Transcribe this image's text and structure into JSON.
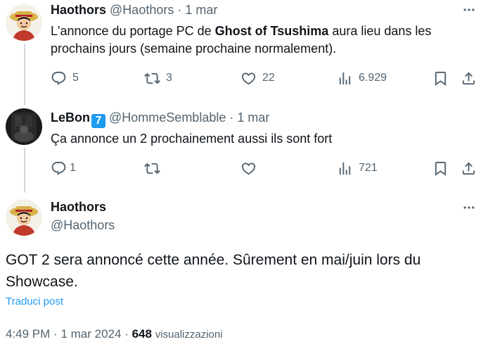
{
  "posts": [
    {
      "name": "Haothors",
      "handle": "@Haothors",
      "separator": "·",
      "date": "1 mar",
      "text_before": "L'annonce du portage PC de ",
      "text_bold": "Ghost of Tsushima",
      "text_after": " aura lieu dans les prochains jours (semaine prochaine normalement).",
      "replies": "5",
      "reposts": "3",
      "likes": "22",
      "views": "6.929"
    },
    {
      "name": "LeBon",
      "badge": "7",
      "handle": "@HommeSemblable",
      "separator": "·",
      "date": "1 mar",
      "text": "Ça annonce un 2 prochainement aussi ils sont fort",
      "replies": "1",
      "reposts": "",
      "likes": "",
      "views": "721"
    }
  ],
  "main_post": {
    "name": "Haothors",
    "handle": "@Haothors",
    "text": "GOT 2 sera annoncé cette année. Sûrement en mai/juin lors du Showcase.",
    "translate_label": "Traduci post",
    "time": "4:49 PM",
    "separator": "·",
    "date": "1 mar 2024",
    "separator2": "·",
    "views_count": "648",
    "views_label": "visualizzazioni"
  },
  "icons": {
    "more": "more-horizontal-icon",
    "reply": "reply-bubble-icon",
    "repost": "repost-arrows-icon",
    "like": "heart-icon",
    "views": "bar-chart-icon",
    "bookmark": "bookmark-icon",
    "share": "share-upload-icon"
  },
  "colors": {
    "text": "#0f1419",
    "secondary": "#536471",
    "accent": "#1d9bf0",
    "thread_line": "#cfd9de"
  }
}
